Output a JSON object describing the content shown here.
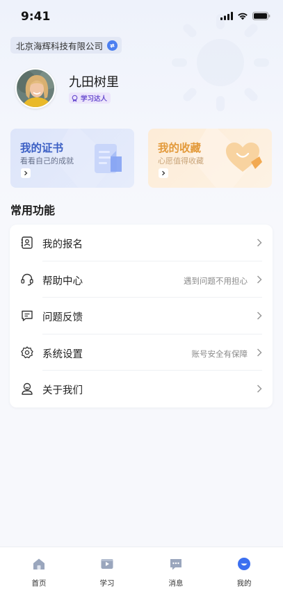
{
  "status_bar": {
    "time": "9:41"
  },
  "company": {
    "name": "北京海辉科技有限公司"
  },
  "profile": {
    "name": "九田树里",
    "badge": "学习达人"
  },
  "cards": [
    {
      "title": "我的证书",
      "subtitle": "看看自己的成就"
    },
    {
      "title": "我的收藏",
      "subtitle": "心愿值得收藏"
    }
  ],
  "section": {
    "title": "常用功能"
  },
  "functions": [
    {
      "label": "我的报名",
      "hint": "",
      "icon": "registration-icon"
    },
    {
      "label": "帮助中心",
      "hint": "遇到问题不用担心",
      "icon": "headset-icon"
    },
    {
      "label": "问题反馈",
      "hint": "",
      "icon": "feedback-icon"
    },
    {
      "label": "系统设置",
      "hint": "账号安全有保障",
      "icon": "settings-icon"
    },
    {
      "label": "关于我们",
      "hint": "",
      "icon": "about-icon"
    }
  ],
  "tabs": [
    {
      "label": "首页",
      "icon": "home-icon",
      "active": false
    },
    {
      "label": "学习",
      "icon": "study-icon",
      "active": false
    },
    {
      "label": "消息",
      "icon": "message-icon",
      "active": false
    },
    {
      "label": "我的",
      "icon": "profile-icon",
      "active": true
    }
  ],
  "colors": {
    "accent": "#3b6ff0",
    "cert_title": "#3b5fc4",
    "fav_title": "#e39a3b",
    "badge_text": "#6a4fd0",
    "tab_icon_inactive": "#9aa6bd"
  }
}
